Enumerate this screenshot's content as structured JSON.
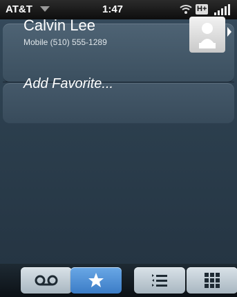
{
  "status_bar": {
    "carrier": "AT&T",
    "time": "1:47",
    "network_badge": "H+",
    "icons": [
      "dropdown-arrow-icon",
      "wifi-icon",
      "signal-bars-icon"
    ]
  },
  "favorites": [
    {
      "name": "Calvin Lee",
      "phone_line": "Mobile (510) 555-1289",
      "photo_icon": "contact-photo-placeholder-icon"
    }
  ],
  "add_favorite": {
    "label": "Add Favorite..."
  },
  "tabs": [
    {
      "id": "voicemail",
      "icon": "voicemail-icon",
      "active": false
    },
    {
      "id": "favorites",
      "icon": "star-icon",
      "active": true
    },
    {
      "id": "call-log",
      "icon": "call-log-icon",
      "active": false
    },
    {
      "id": "dialpad",
      "icon": "dialpad-icon",
      "active": false
    }
  ],
  "colors": {
    "active_tab": "#4a8fd6",
    "background": "#2c3f4e",
    "text": "#ffffff"
  }
}
